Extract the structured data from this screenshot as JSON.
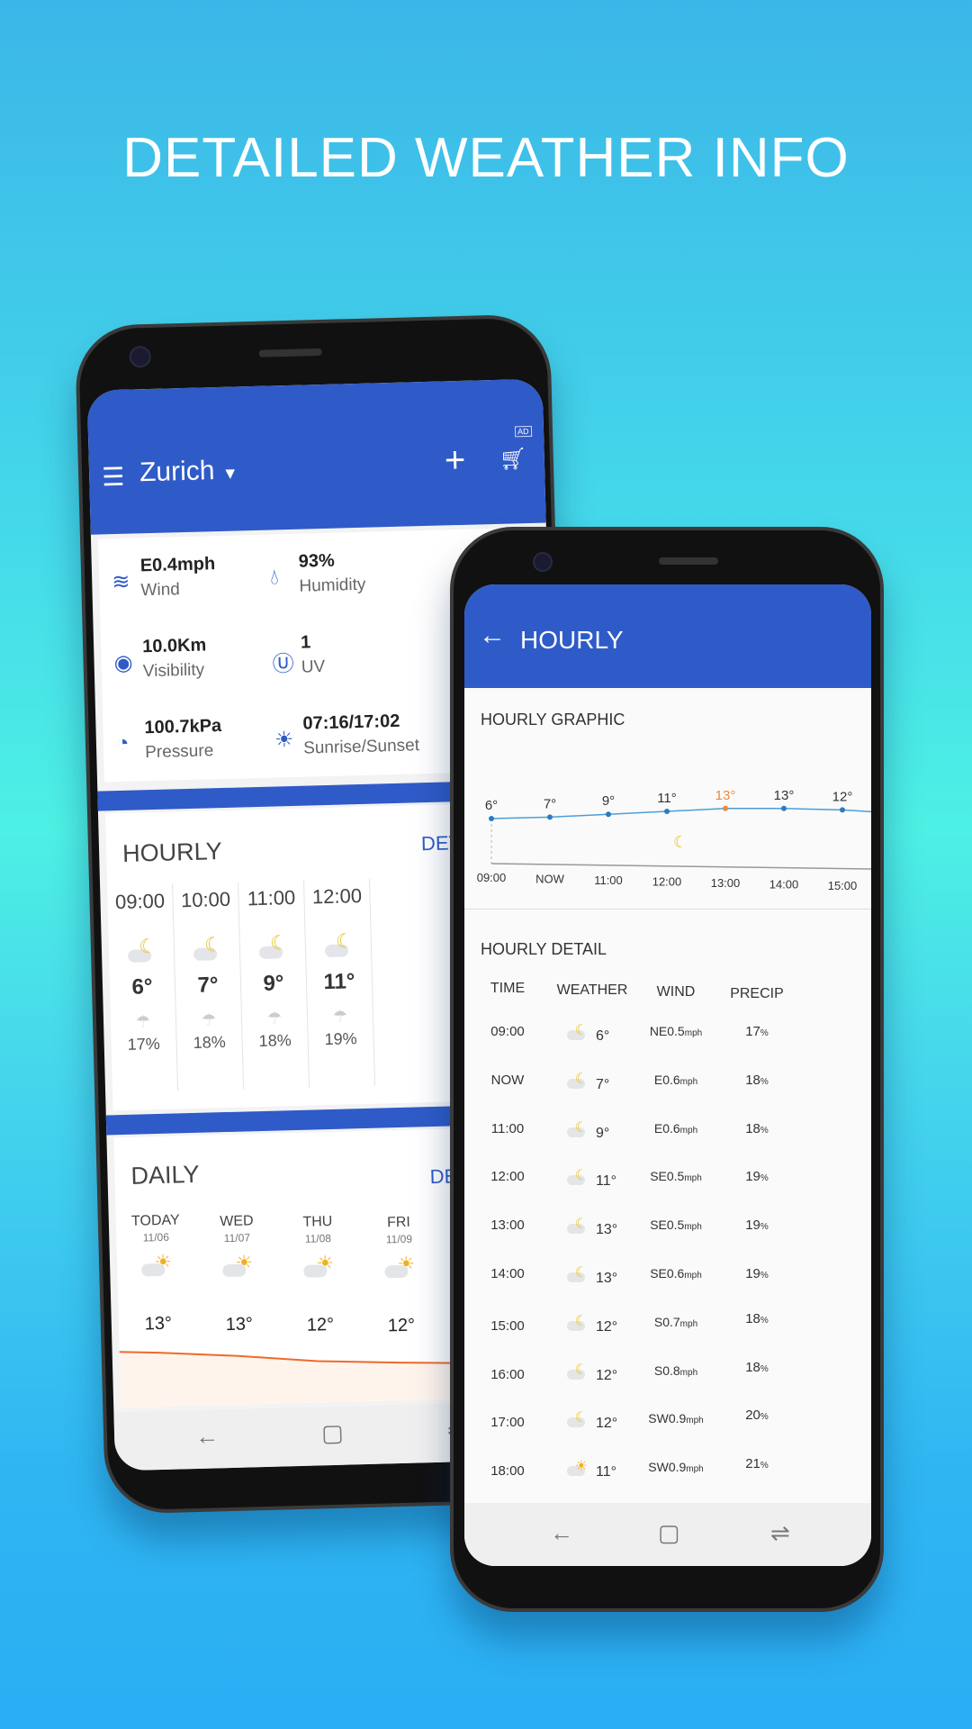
{
  "headline": "DETAILED WEATHER INFO",
  "main_screen": {
    "header": {
      "city": "Zurich",
      "ad_badge": "AD"
    },
    "conditions": [
      {
        "icon": "wind-icon",
        "value": "E0.4mph",
        "label": "Wind"
      },
      {
        "icon": "humidity-drop-icon",
        "value": "93%",
        "label": "Humidity"
      },
      {
        "icon": "eye-icon",
        "value": "10.0Km",
        "label": "Visibility"
      },
      {
        "icon": "uv-icon",
        "value": "1",
        "label": "UV"
      },
      {
        "icon": "gauge-icon",
        "value": "100.7kPa",
        "label": "Pressure"
      },
      {
        "icon": "sunrise-icon",
        "value": "07:16/17:02",
        "label": "Sunrise/Sunset"
      }
    ],
    "hourly": {
      "title": "HOURLY",
      "details_link": "DETAILS",
      "items": [
        {
          "time": "09:00",
          "temp": "6°",
          "precip": "17%"
        },
        {
          "time": "10:00",
          "temp": "7°",
          "precip": "18%"
        },
        {
          "time": "11:00",
          "temp": "9°",
          "precip": "18%"
        },
        {
          "time": "12:00",
          "temp": "11°",
          "precip": "19%"
        }
      ]
    },
    "daily": {
      "title": "DAILY",
      "details_link": "DETAILS",
      "items": [
        {
          "day": "TODAY",
          "date": "11/06",
          "temp": "13°"
        },
        {
          "day": "WED",
          "date": "11/07",
          "temp": "13°"
        },
        {
          "day": "THU",
          "date": "11/08",
          "temp": "12°"
        },
        {
          "day": "FRI",
          "date": "11/09",
          "temp": "12°"
        }
      ]
    }
  },
  "hourly_screen": {
    "title": "HOURLY",
    "graphic_title": "HOURLY GRAPHIC",
    "chart_data": {
      "type": "line",
      "categories": [
        "09:00",
        "NOW",
        "11:00",
        "12:00",
        "13:00",
        "14:00",
        "15:00"
      ],
      "values": [
        6,
        7,
        9,
        11,
        13,
        13,
        12
      ],
      "labels": [
        "6°",
        "7°",
        "9°",
        "11°",
        "13°",
        "13°",
        "12°"
      ],
      "highlight_index": 4,
      "line_color": "#4a9fd8",
      "highlight_color": "#f0883a"
    },
    "detail_title": "HOURLY DETAIL",
    "columns": [
      "TIME",
      "WEATHER",
      "WIND",
      "PRECIP"
    ],
    "rows": [
      {
        "time": "09:00",
        "temp": "6°",
        "wind": "NE0.5",
        "unit": "mph",
        "precip": "17",
        "pu": "%"
      },
      {
        "time": "NOW",
        "temp": "7°",
        "wind": "E0.6",
        "unit": "mph",
        "precip": "18",
        "pu": "%"
      },
      {
        "time": "11:00",
        "temp": "9°",
        "wind": "E0.6",
        "unit": "mph",
        "precip": "18",
        "pu": "%"
      },
      {
        "time": "12:00",
        "temp": "11°",
        "wind": "SE0.5",
        "unit": "mph",
        "precip": "19",
        "pu": "%"
      },
      {
        "time": "13:00",
        "temp": "13°",
        "wind": "SE0.5",
        "unit": "mph",
        "precip": "19",
        "pu": "%"
      },
      {
        "time": "14:00",
        "temp": "13°",
        "wind": "SE0.6",
        "unit": "mph",
        "precip": "19",
        "pu": "%"
      },
      {
        "time": "15:00",
        "temp": "12°",
        "wind": "S0.7",
        "unit": "mph",
        "precip": "18",
        "pu": "%"
      },
      {
        "time": "16:00",
        "temp": "12°",
        "wind": "S0.8",
        "unit": "mph",
        "precip": "18",
        "pu": "%"
      },
      {
        "time": "17:00",
        "temp": "12°",
        "wind": "SW0.9",
        "unit": "mph",
        "precip": "20",
        "pu": "%"
      },
      {
        "time": "18:00",
        "temp": "11°",
        "wind": "SW0.9",
        "unit": "mph",
        "precip": "21",
        "pu": "%"
      }
    ]
  },
  "colors": {
    "header_blue": "#2f5bc8",
    "accent_orange": "#f0883a"
  }
}
